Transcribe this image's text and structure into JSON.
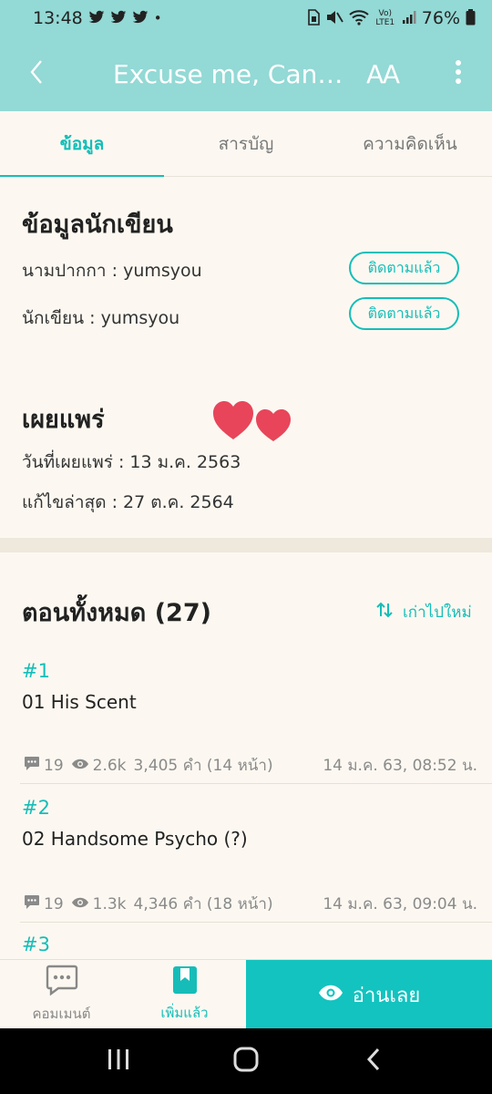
{
  "status_bar": {
    "time": "13:48",
    "notification_icons": [
      "twitter-icon",
      "twitter-icon",
      "twitter-icon",
      "dot-icon"
    ],
    "network_label": "Vo) LTE1",
    "battery": "76%"
  },
  "header": {
    "title": "Excuse me, Can I...",
    "font_button": "AA",
    "colors": {
      "bar": "#93d9d5",
      "accent": "#16bdb8"
    }
  },
  "tabs": [
    {
      "label": "ข้อมูล",
      "active": true
    },
    {
      "label": "สารบัญ",
      "active": false
    },
    {
      "label": "ความคิดเห็น",
      "active": false
    }
  ],
  "writer_info": {
    "heading": "ข้อมูลนักเขียน",
    "rows": [
      {
        "label": "นามปากกา : yumsyou",
        "button": "ติดตามแล้ว"
      },
      {
        "label": "นักเขียน : yumsyou",
        "button": "ติดตามแล้ว"
      }
    ]
  },
  "publish": {
    "heading": "เผยแพร่",
    "published": "วันที่เผยแพร่ : 13 ม.ค. 2563",
    "updated": "แก้ไขล่าสุด : 27 ต.ค. 2564"
  },
  "episodes": {
    "heading": "ตอนทั้งหมด (27)",
    "sort_label": "เก่าไปใหม่",
    "items": [
      {
        "number": "#1",
        "title": "01 His Scent",
        "comments": "19",
        "views": "2.6k",
        "words": "3,405 คำ (14 หน้า)",
        "date": "14 ม.ค. 63, 08:52 น."
      },
      {
        "number": "#2",
        "title": "02 Handsome Psycho (?)",
        "comments": "19",
        "views": "1.3k",
        "words": "4,346 คำ (18 หน้า)",
        "date": "14 ม.ค. 63, 09:04 น."
      },
      {
        "number": "#3"
      }
    ]
  },
  "bottom_bar": {
    "comment_label": "คอมเมนต์",
    "added_label": "เพิ่มแล้ว",
    "read_label": "อ่านเลย"
  }
}
